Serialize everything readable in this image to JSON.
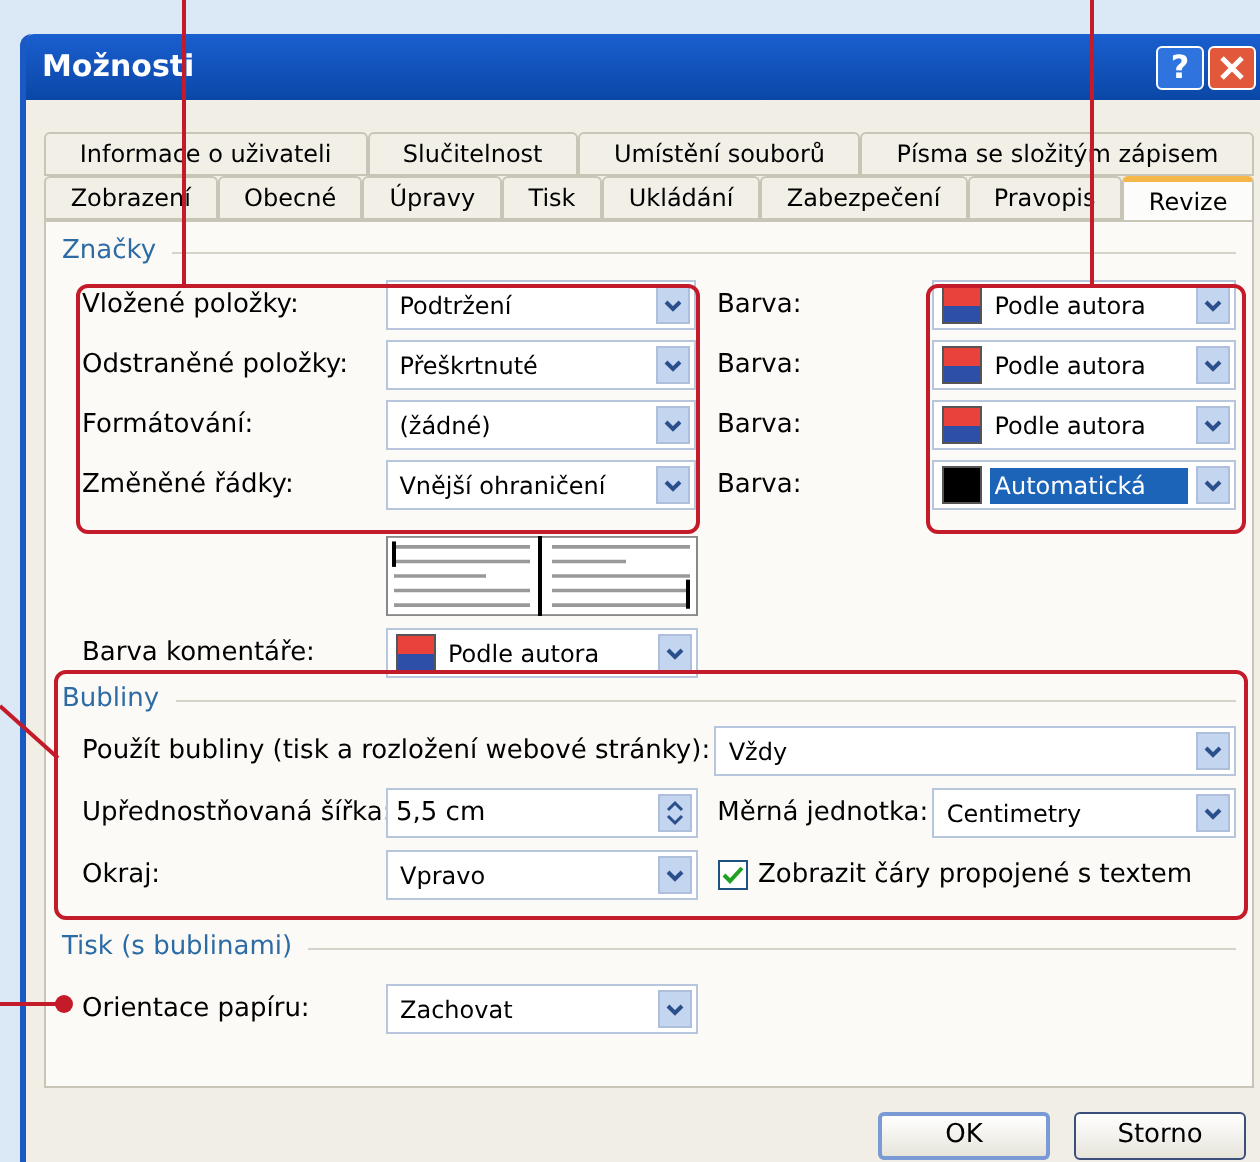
{
  "window": {
    "title": "Možnosti",
    "help_label": "?"
  },
  "tabs": [
    [
      {
        "label": "Informace o uživateli",
        "selected": false
      },
      {
        "label": "Slučitelnost",
        "selected": false
      },
      {
        "label": "Umístění souborů",
        "selected": false
      },
      {
        "label": "Písma se složitým zápisem",
        "selected": false
      }
    ],
    [
      {
        "label": "Zobrazení",
        "selected": false
      },
      {
        "label": "Obecné",
        "selected": false
      },
      {
        "label": "Úpravy",
        "selected": false
      },
      {
        "label": "Tisk",
        "selected": false
      },
      {
        "label": "Ukládání",
        "selected": false
      },
      {
        "label": "Zabezpečení",
        "selected": false
      },
      {
        "label": "Pravopis",
        "selected": false
      },
      {
        "label": "Revize",
        "selected": true
      }
    ]
  ],
  "markup": {
    "title": "Značky",
    "rows": [
      {
        "label": "Vložené položky:",
        "value": "Podtržení",
        "color_label": "Barva:",
        "color_value": "Podle autora",
        "swatch_split": true,
        "highlighted": false
      },
      {
        "label": "Odstraněné položky:",
        "value": "Přeškrtnuté",
        "color_label": "Barva:",
        "color_value": "Podle autora",
        "swatch_split": true,
        "highlighted": false
      },
      {
        "label": "Formátování:",
        "value": "(žádné)",
        "color_label": "Barva:",
        "color_value": "Podle autora",
        "swatch_split": true,
        "highlighted": false
      },
      {
        "label": "Změněné řádky:",
        "value": "Vnější ohraničení",
        "color_label": "Barva:",
        "color_value": "Automatická",
        "swatch_split": false,
        "highlighted": true
      }
    ]
  },
  "comment_color": {
    "label": "Barva komentáře:",
    "value": "Podle autora",
    "swatch_split": true
  },
  "balloons": {
    "title": "Bubliny",
    "use": {
      "label": "Použít bubliny (tisk a rozložení webové stránky):",
      "value": "Vždy"
    },
    "width": {
      "label": "Upřednostňovaná šířka:",
      "value": "5,5 cm"
    },
    "unit": {
      "label": "Měrná jednotka:",
      "value": "Centimetry"
    },
    "margin": {
      "label": "Okraj:",
      "value": "Vpravo"
    },
    "show_lines": {
      "label": "Zobrazit čáry propojené s textem",
      "checked": true
    }
  },
  "printing": {
    "title": "Tisk (s bublinami)",
    "orientation": {
      "label": "Orientace papíru:",
      "value": "Zachovat"
    }
  },
  "buttons": [
    {
      "label": "OK",
      "default": true
    },
    {
      "label": "Storno",
      "default": false
    }
  ]
}
